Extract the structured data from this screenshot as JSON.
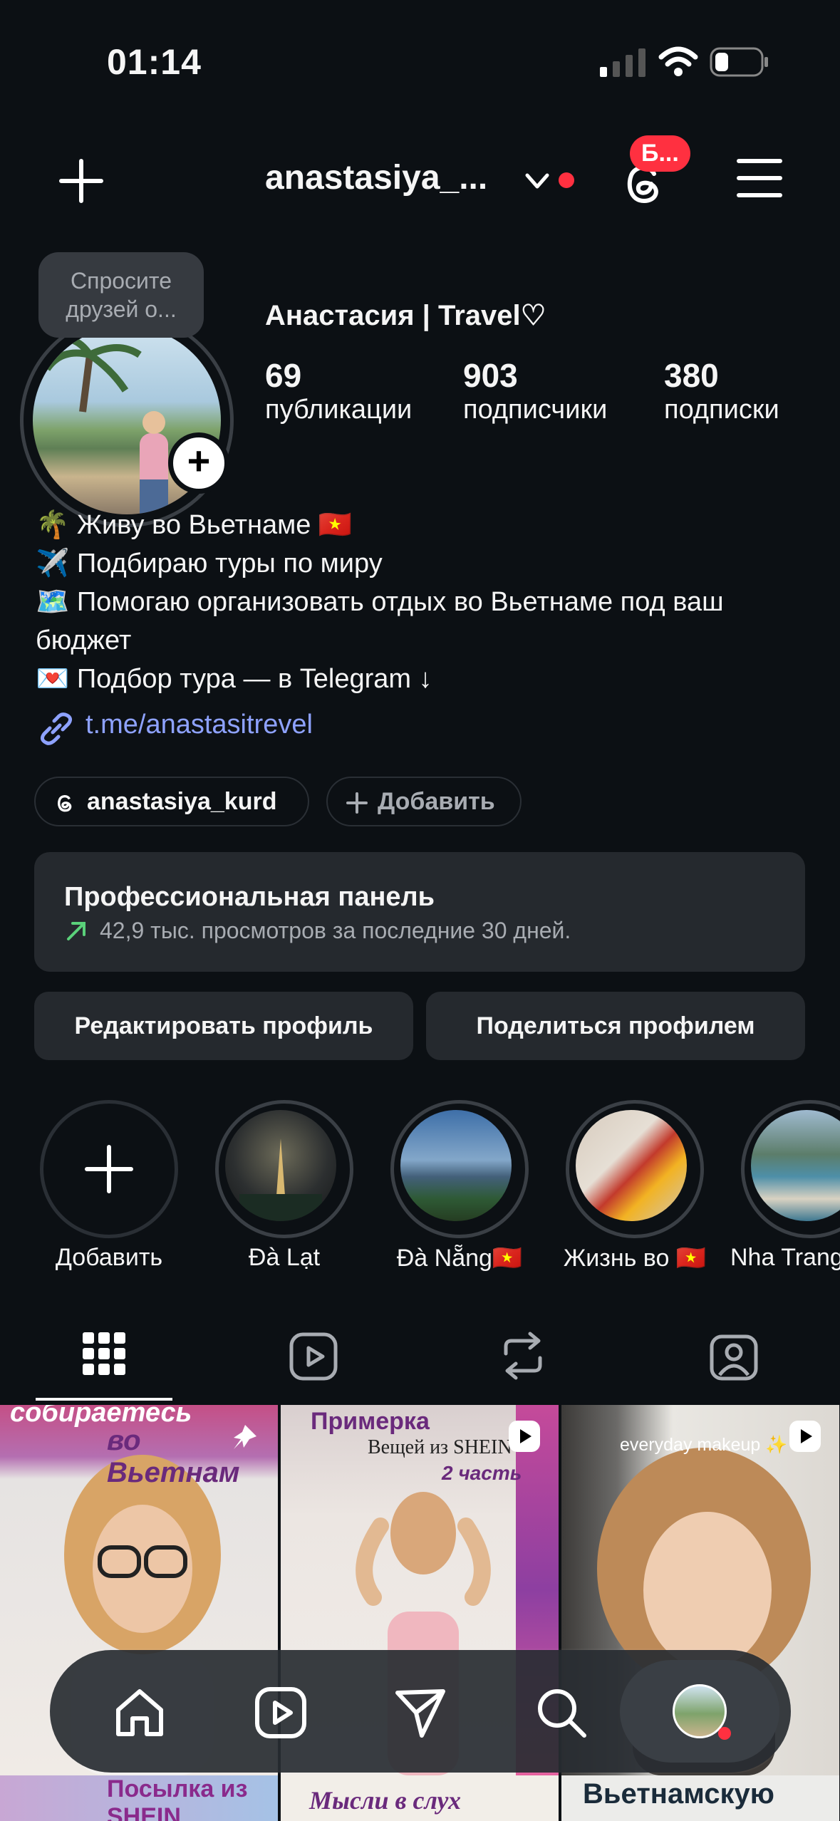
{
  "status_bar": {
    "time": "01:14"
  },
  "header": {
    "username": "anastasiya_...",
    "notif_badge": "Б..."
  },
  "profile": {
    "bubble": "Спросите друзей о...",
    "display_name": "Анастасия | Travel♡",
    "stats": [
      {
        "value": "69",
        "label": "публикации"
      },
      {
        "value": "903",
        "label": "подписчики"
      },
      {
        "value": "380",
        "label": "подписки"
      }
    ],
    "bio": [
      "🌴 Живу во Вьетнаме 🇻🇳",
      "✈️ Подбираю туры по миру",
      "🗺️ Помогаю организовать отдых во Вьетнаме под ваш бюджет",
      "💌 Подбор тура — в Telegram ↓"
    ],
    "link": "t.me/anastasitrevel",
    "threads_handle": "anastasiya_kurd",
    "add_label": "Добавить"
  },
  "pro_dashboard": {
    "title": "Профессиональная панель",
    "subtitle": "42,9 тыс. просмотров за последние 30 дней."
  },
  "buttons": {
    "edit": "Редактировать профиль",
    "share": "Поделиться профилем"
  },
  "highlights": [
    {
      "label": "Добавить"
    },
    {
      "label": "Đà Lạt"
    },
    {
      "label": "Đà Nẵng🇻🇳"
    },
    {
      "label": "Жизнь во 🇻🇳"
    },
    {
      "label": "Nha Trang"
    }
  ],
  "posts": [
    {
      "caption_line1": "собираетесь",
      "caption_line2": "во Вьетнам"
    },
    {
      "caption_line1": "Примерка",
      "caption_line2": "Вещей из SHEIN",
      "caption_line3": "2 часть"
    },
    {
      "caption_line1": "everyday makeup ✨"
    }
  ],
  "bottom_row": [
    {
      "caption": "Посылка из SHEIN"
    },
    {
      "caption": "Мысли в слух"
    },
    {
      "caption": "Вьетнамскую"
    }
  ]
}
